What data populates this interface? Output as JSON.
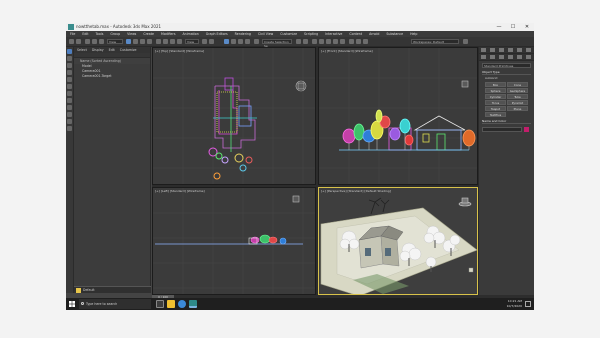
{
  "window": {
    "title": "nowtthetab.max - Autodesk 3ds Max 2021",
    "controls": [
      "—",
      "☐",
      "✕"
    ]
  },
  "menubar": {
    "items": [
      "File",
      "Edit",
      "Tools",
      "Group",
      "Views",
      "Create",
      "Modifiers",
      "Animation",
      "Graph Editors",
      "Rendering",
      "Civil View",
      "Customize",
      "Scripting",
      "Interactive",
      "Content",
      "Arnold",
      "Substance",
      "Help"
    ]
  },
  "toolbar": {
    "view_combo": "View",
    "selset_combo": "Create Selection Se",
    "workspace_combo": "Workspaces: Default"
  },
  "scene_explorer": {
    "tabs": [
      "Select",
      "Display",
      "Edit",
      "Customize"
    ],
    "header": "Name (Sorted Ascending)",
    "rows": [
      "Model",
      "Camera001",
      "Camera001.Target"
    ],
    "layer": "Default"
  },
  "viewports": {
    "top_label": "[+] [Top] [Standard] [Wireframe]",
    "front_label": "[+] [Front] [Standard] [Wireframe]",
    "left_label": "[+] [Left] [Standard] [Wireframe]",
    "persp_label": "[+] [Perspective] [Standard] [Default Shading]"
  },
  "command_panel": {
    "category": "Standard Primitives",
    "object_type_title": "Object Type",
    "autogrid": "AutoGrid",
    "primitives": [
      "Box",
      "Cone",
      "Sphere",
      "GeoSphere",
      "Cylinder",
      "Tube",
      "Torus",
      "Pyramid",
      "Teapot",
      "Plane",
      "TextPlus"
    ],
    "name_color_title": "Name and Color"
  },
  "timeline": {
    "slider": "0 / 100"
  },
  "status": {
    "line1": "None Selected",
    "line2": "Click or click-and-drag to select objects",
    "xyz": "X: 5'2\"  Y:  Z: ",
    "grid": "Grid = 10'0\"",
    "add_time_tag": "Add Time Tag",
    "autokey": "Auto Key",
    "setkey": "Set Key",
    "selected": "Selected"
  },
  "taskbar": {
    "search_placeholder": "Type here to search",
    "time": "10:21 AM",
    "date": "10/7/2020"
  }
}
